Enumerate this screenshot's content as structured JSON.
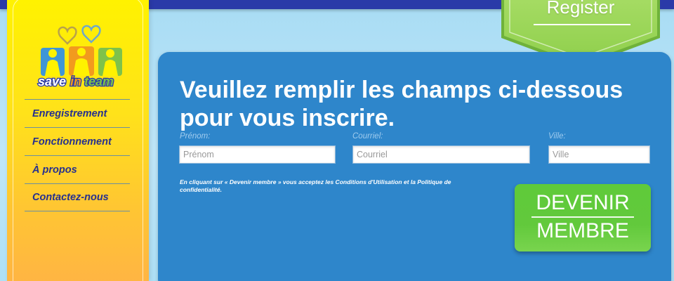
{
  "brand": {
    "logo_alt": "saveinteam",
    "logo_text_a": "save",
    "logo_text_b": "in",
    "logo_text_c": "team"
  },
  "sidebar": {
    "items": [
      {
        "label": "Enregistrement"
      },
      {
        "label": "Fonctionnement"
      },
      {
        "label": "À propos"
      },
      {
        "label": "Contactez-nous"
      }
    ]
  },
  "header": {
    "register_label": "Register"
  },
  "form": {
    "headline": "Veuillez remplir les champs ci-dessous pour vous inscrire.",
    "fields": [
      {
        "label": "Prénom:",
        "placeholder": "Prénom",
        "value": ""
      },
      {
        "label": "Courriel:",
        "placeholder": "Courriel",
        "value": ""
      },
      {
        "label": "Ville:",
        "placeholder": "Ville",
        "value": ""
      }
    ],
    "terms": "En cliquant sur « Devenir membre » vous acceptez les Conditions d'Utilisation et la Politique de confidentialité.",
    "submit_line1": "DEVENIR",
    "submit_line2": "MEMBRE"
  },
  "colors": {
    "topbar": "#2a3aa8",
    "sidebar_top": "#fff200",
    "sidebar_bottom": "#ffb543",
    "panel": "#2e86cb",
    "accent_green": "#5fca3a",
    "nav_text": "#26308f"
  }
}
